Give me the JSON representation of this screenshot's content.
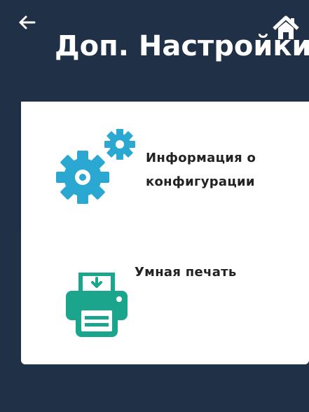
{
  "header": {
    "title": "Доп. Настройки",
    "back_icon": "back-arrow-icon",
    "home_icon": "home-icon"
  },
  "tiles": [
    {
      "label": "Информация о конфигурации",
      "icon": "gears-icon"
    },
    {
      "label": "Умная печать",
      "icon": "printer-icon"
    }
  ],
  "colors": {
    "background": "#1f3047",
    "tile": "#ffffff",
    "icon": "#2aa8d2",
    "printer": "#1aa58c"
  }
}
